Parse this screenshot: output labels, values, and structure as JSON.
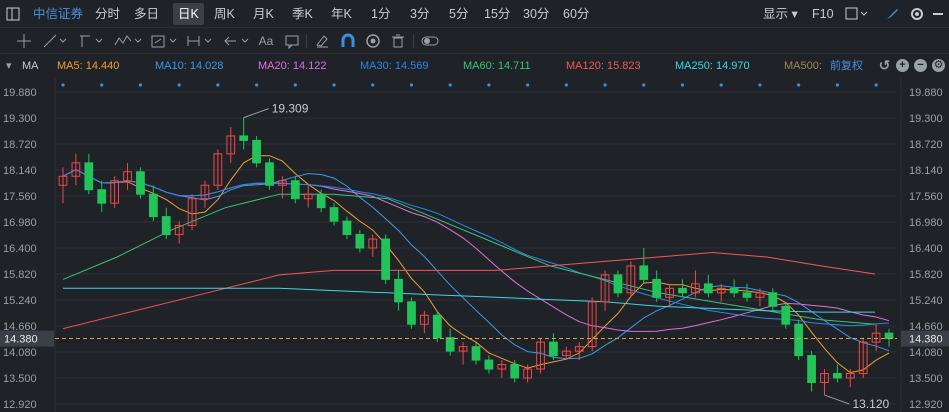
{
  "topbar": {
    "layout_icon": "layout-toggle-icon",
    "stock_name": "中信证券",
    "periods": [
      "分时",
      "多日",
      "日K",
      "周K",
      "月K",
      "季K",
      "年K",
      "1分",
      "3分",
      "5分",
      "15分",
      "30分",
      "60分"
    ],
    "active_period": "日K",
    "display_label": "显示",
    "f10_label": "F10"
  },
  "toolbar": {
    "icons": [
      "crosshair-icon",
      "line-tool-icon",
      "channel-tool-icon",
      "wave-tool-icon",
      "measure-tool-icon",
      "range-tool-icon",
      "arrow-left-icon",
      "text-tool-icon",
      "comment-icon",
      "eraser-icon",
      "magnet-icon",
      "eye-icon",
      "trash-icon",
      "toggle-icon"
    ],
    "text_label": "Aa"
  },
  "ma_bar": {
    "name": "MA",
    "items": [
      {
        "label": "MA5: 14.440",
        "color": "#f0a030"
      },
      {
        "label": "MA10: 14.028",
        "color": "#3a9bea"
      },
      {
        "label": "MA20: 14.122",
        "color": "#e070e0"
      },
      {
        "label": "MA30: 14.569",
        "color": "#2f86e6"
      },
      {
        "label": "MA60: 14.711",
        "color": "#37c47a"
      },
      {
        "label": "MA120: 15.823",
        "color": "#f05a5a"
      },
      {
        "label": "MA250: 14.970",
        "color": "#3fd6e8"
      },
      {
        "label": "MA500:",
        "color": "#9a8a50"
      }
    ],
    "adjust_label": "前复权"
  },
  "colors": {
    "up": "#f04848",
    "down": "#22c45a",
    "bg": "#1f2227",
    "grid": "#2e323a",
    "dot": "#3a8fe0"
  },
  "chart_data": {
    "type": "candlestick",
    "y_ticks": [
      "19.880",
      "19.300",
      "18.720",
      "18.140",
      "17.560",
      "16.980",
      "16.400",
      "15.820",
      "15.240",
      "14.660",
      "14.080",
      "13.500",
      "12.920"
    ],
    "ylim": [
      12.92,
      19.88
    ],
    "current_price": "14.380",
    "max_label": "19.309",
    "min_label": "13.120",
    "candles": [
      [
        17.8,
        18.2,
        17.4,
        18.0
      ],
      [
        18.0,
        18.5,
        17.8,
        18.3
      ],
      [
        18.3,
        18.5,
        17.6,
        17.7
      ],
      [
        17.7,
        17.9,
        17.2,
        17.4
      ],
      [
        17.4,
        18.0,
        17.3,
        17.9
      ],
      [
        17.9,
        18.3,
        17.7,
        18.1
      ],
      [
        18.1,
        18.2,
        17.5,
        17.6
      ],
      [
        17.6,
        17.8,
        17.0,
        17.1
      ],
      [
        17.1,
        17.3,
        16.6,
        16.7
      ],
      [
        16.7,
        17.0,
        16.5,
        16.9
      ],
      [
        16.9,
        17.6,
        16.8,
        17.5
      ],
      [
        17.5,
        17.9,
        17.3,
        17.8
      ],
      [
        17.8,
        18.6,
        17.7,
        18.5
      ],
      [
        18.5,
        19.1,
        18.3,
        18.9
      ],
      [
        18.9,
        19.309,
        18.6,
        18.8
      ],
      [
        18.8,
        18.9,
        18.2,
        18.3
      ],
      [
        18.3,
        18.4,
        17.7,
        17.8
      ],
      [
        17.8,
        18.0,
        17.5,
        17.9
      ],
      [
        17.9,
        18.0,
        17.4,
        17.5
      ],
      [
        17.5,
        17.8,
        17.3,
        17.6
      ],
      [
        17.6,
        17.7,
        17.2,
        17.3
      ],
      [
        17.3,
        17.4,
        16.9,
        17.0
      ],
      [
        17.0,
        17.1,
        16.6,
        16.7
      ],
      [
        16.7,
        16.8,
        16.3,
        16.4
      ],
      [
        16.4,
        16.7,
        16.2,
        16.6
      ],
      [
        16.6,
        16.7,
        15.6,
        15.7
      ],
      [
        15.7,
        15.9,
        15.0,
        15.2
      ],
      [
        15.2,
        15.3,
        14.6,
        14.7
      ],
      [
        14.7,
        15.0,
        14.5,
        14.9
      ],
      [
        14.9,
        15.0,
        14.3,
        14.4
      ],
      [
        14.4,
        14.6,
        14.0,
        14.1
      ],
      [
        14.1,
        14.3,
        13.8,
        14.2
      ],
      [
        14.2,
        14.3,
        13.8,
        13.9
      ],
      [
        13.9,
        14.0,
        13.6,
        13.7
      ],
      [
        13.7,
        13.9,
        13.5,
        13.8
      ],
      [
        13.8,
        13.9,
        13.4,
        13.5
      ],
      [
        13.5,
        13.8,
        13.4,
        13.7
      ],
      [
        13.7,
        14.4,
        13.6,
        14.3
      ],
      [
        14.3,
        14.5,
        13.9,
        14.0
      ],
      [
        14.0,
        14.2,
        13.9,
        14.1
      ],
      [
        14.1,
        14.3,
        13.9,
        14.2
      ],
      [
        14.2,
        15.3,
        14.1,
        15.2
      ],
      [
        15.2,
        15.9,
        15.0,
        15.8
      ],
      [
        15.8,
        15.9,
        15.3,
        15.4
      ],
      [
        15.4,
        16.1,
        15.3,
        16.0
      ],
      [
        16.0,
        16.4,
        15.6,
        15.7
      ],
      [
        15.7,
        15.9,
        15.2,
        15.3
      ],
      [
        15.3,
        15.6,
        15.1,
        15.5
      ],
      [
        15.5,
        15.7,
        15.3,
        15.4
      ],
      [
        15.4,
        15.9,
        15.3,
        15.6
      ],
      [
        15.6,
        15.8,
        15.3,
        15.4
      ],
      [
        15.4,
        15.6,
        15.2,
        15.5
      ],
      [
        15.5,
        15.7,
        15.3,
        15.4
      ],
      [
        15.4,
        15.6,
        15.2,
        15.3
      ],
      [
        15.3,
        15.5,
        15.1,
        15.4
      ],
      [
        15.4,
        15.5,
        15.0,
        15.1
      ],
      [
        15.1,
        15.2,
        14.6,
        14.7
      ],
      [
        14.7,
        14.8,
        13.9,
        14.0
      ],
      [
        14.0,
        14.1,
        13.2,
        13.4
      ],
      [
        13.4,
        13.7,
        13.12,
        13.6
      ],
      [
        13.6,
        13.8,
        13.4,
        13.5
      ],
      [
        13.5,
        13.7,
        13.3,
        13.6
      ],
      [
        13.6,
        14.4,
        13.5,
        14.3
      ],
      [
        14.3,
        14.7,
        14.1,
        14.5
      ],
      [
        14.5,
        14.6,
        14.2,
        14.38
      ]
    ]
  }
}
